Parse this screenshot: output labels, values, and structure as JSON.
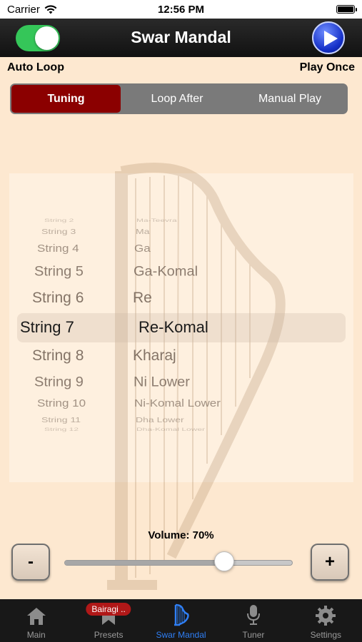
{
  "status_bar": {
    "carrier": "Carrier",
    "time": "12:56 PM"
  },
  "header": {
    "title": "Swar Mandal",
    "auto_loop_on": true
  },
  "labels": {
    "auto_loop": "Auto Loop",
    "play_once": "Play Once"
  },
  "segments": [
    {
      "label": "Tuning",
      "active": true
    },
    {
      "label": "Loop After",
      "active": false
    },
    {
      "label": "Manual Play",
      "active": false
    }
  ],
  "picker": {
    "selected_index": 6,
    "rows": [
      {
        "string": "String 2",
        "note": "Ma-Teevra"
      },
      {
        "string": "String 3",
        "note": "Ma"
      },
      {
        "string": "String 4",
        "note": "Ga"
      },
      {
        "string": "String 5",
        "note": "Ga-Komal"
      },
      {
        "string": "String 6",
        "note": "Re"
      },
      {
        "string": "String 7",
        "note": "Re-Komal"
      },
      {
        "string": "String 8",
        "note": "Kharaj"
      },
      {
        "string": "String 9",
        "note": "Ni Lower"
      },
      {
        "string": "String 10",
        "note": "Ni-Komal Lower"
      },
      {
        "string": "String 11",
        "note": "Dha Lower"
      },
      {
        "string": "String 12",
        "note": "Dha-Komal Lower"
      }
    ]
  },
  "volume": {
    "label": "Volume: 70%",
    "value": 0.7,
    "minus": "-",
    "plus": "+"
  },
  "tabs": [
    {
      "label": "Main",
      "icon": "house-icon",
      "active": false
    },
    {
      "label": "Presets",
      "icon": "ribbon-icon",
      "active": false,
      "badge": "Bairagi .."
    },
    {
      "label": "Swar Mandal",
      "icon": "harp-icon",
      "active": true
    },
    {
      "label": "Tuner",
      "icon": "microphone-icon",
      "active": false
    },
    {
      "label": "Settings",
      "icon": "gear-icon",
      "active": false
    }
  ],
  "colors": {
    "background": "#fde8d0",
    "toggle_on": "#35c659",
    "segment_active": "#8b0000",
    "tab_active": "#2f7ff5",
    "badge": "#b01818"
  }
}
